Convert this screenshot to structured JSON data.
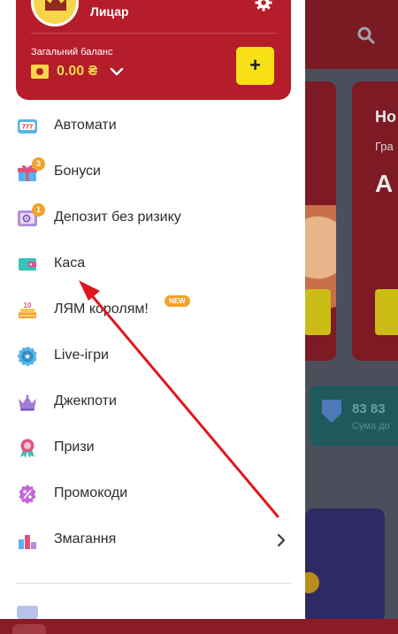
{
  "user": {
    "name": "Лицар"
  },
  "balance": {
    "label": "Загальний баланс",
    "amount": "0.00 ₴",
    "deposit_label": "+"
  },
  "menu": {
    "items": [
      {
        "label": "Автомати",
        "icon": "slots-777-icon"
      },
      {
        "label": "Бонуси",
        "icon": "gift-icon",
        "badge": "3"
      },
      {
        "label": "Депозит без ризику",
        "icon": "safe-icon",
        "badge": "1"
      },
      {
        "label": "Каса",
        "icon": "wallet-icon"
      },
      {
        "label": "ЛЯМ королям!",
        "icon": "cake-icon",
        "tag": "NEW"
      },
      {
        "label": "Live-ігри",
        "icon": "casino-chip-icon"
      },
      {
        "label": "Джекпоти",
        "icon": "crown-icon"
      },
      {
        "label": "Призи",
        "icon": "medal-icon"
      },
      {
        "label": "Промокоди",
        "icon": "percent-icon"
      },
      {
        "label": "Змагання",
        "icon": "podium-icon"
      }
    ]
  },
  "background": {
    "card_title": "Но",
    "card_sub": "Гра",
    "card_big": "А",
    "stat_number": "83 83",
    "stat_caption": "Сума до"
  },
  "colors": {
    "brand_red": "#b51d2a",
    "accent_yellow": "#f7e017",
    "badge_orange": "#f2a12a",
    "annotation_arrow": "#e0161e"
  }
}
